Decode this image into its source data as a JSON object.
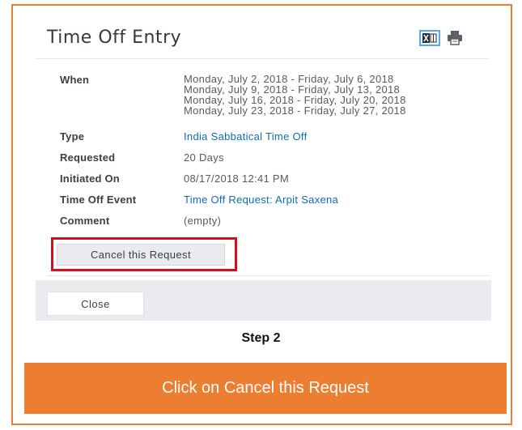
{
  "dialog": {
    "title": "Time Off Entry",
    "icons": [
      "excel-export-icon",
      "print-icon"
    ]
  },
  "fields": {
    "when": {
      "label": "When",
      "lines": [
        "Monday, July 2, 2018 - Friday, July 6, 2018",
        "Monday, July 9, 2018 - Friday, July 13, 2018",
        "Monday, July 16, 2018 - Friday, July 20, 2018",
        "Monday, July 23, 2018 - Friday, July 27, 2018"
      ]
    },
    "type": {
      "label": "Type",
      "value": "India Sabbatical Time Off"
    },
    "requested": {
      "label": "Requested",
      "value": "20 Days"
    },
    "initiated_on": {
      "label": "Initiated On",
      "value": "08/17/2018 12:41 PM"
    },
    "time_off_event": {
      "label": "Time Off Event",
      "value": "Time Off Request: Arpit Saxena"
    },
    "comment": {
      "label": "Comment",
      "value": "(empty)"
    }
  },
  "actions": {
    "cancel_label": "Cancel this Request",
    "close_label": "Close"
  },
  "caption": {
    "step": "Step 2",
    "instruction": "Click on Cancel this Request"
  },
  "colors": {
    "frame": "#ed7d31",
    "banner": "#ed7d31",
    "highlight": "#d0121b",
    "link": "#0b6fb0"
  }
}
